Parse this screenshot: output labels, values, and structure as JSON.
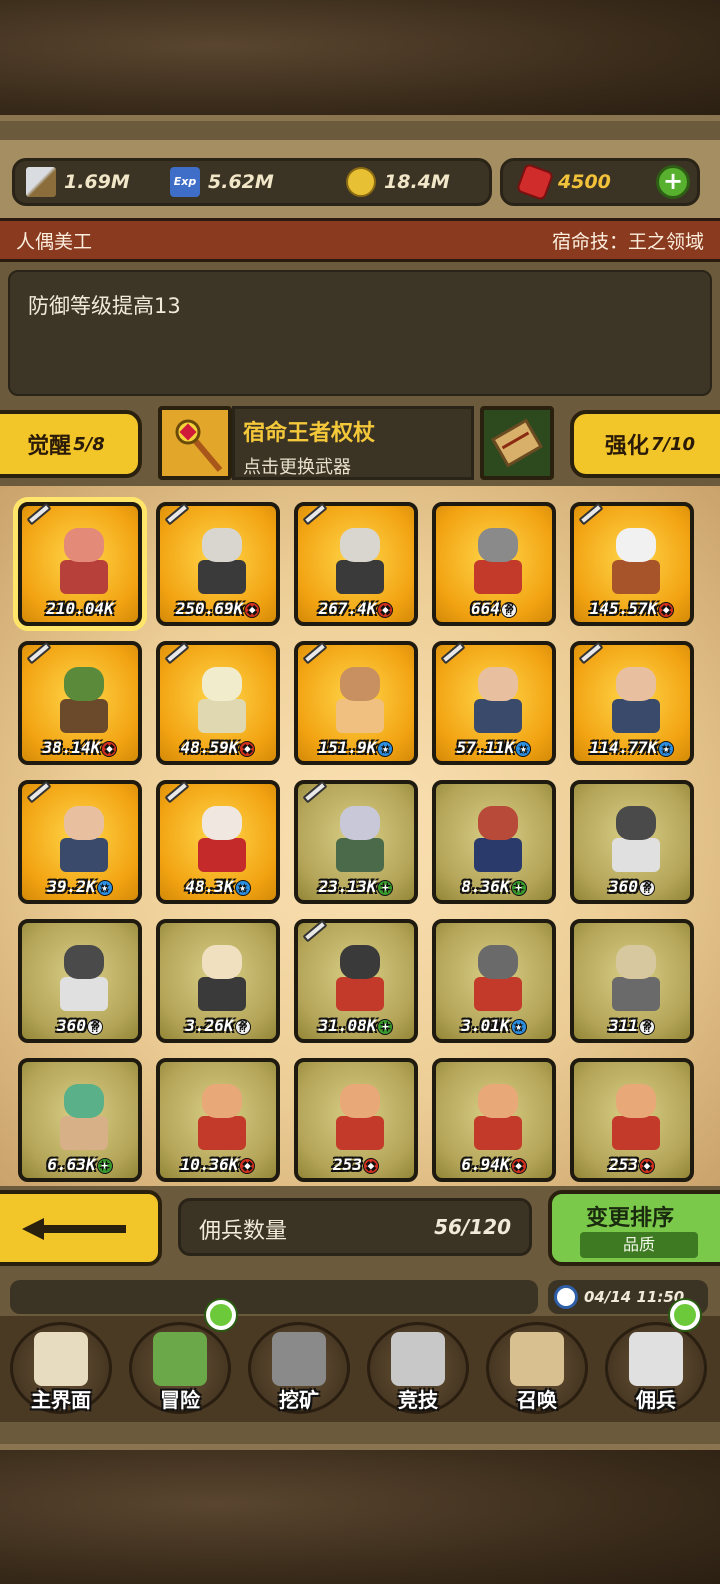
{
  "currency": {
    "attack": "1.69M",
    "exp": "5.62M",
    "gold": "18.4M",
    "ruby": "4500"
  },
  "destiny": {
    "name": "人偶美工",
    "skill": "宿命技：王之领域",
    "description": "防御等级提高13"
  },
  "awaken": {
    "label": "觉醒",
    "value": "5/8"
  },
  "enhance": {
    "label": "强化",
    "value": "7/10"
  },
  "weapon": {
    "name": "宿命王者权杖",
    "hint": "点击更换武器"
  },
  "heroes": [
    {
      "value": "210.04K",
      "badge": "",
      "frame": "gold",
      "sword": true
    },
    {
      "value": "250.69K",
      "badge": "red",
      "frame": "gold",
      "sword": true
    },
    {
      "value": "267.4K",
      "badge": "red",
      "frame": "gold",
      "sword": true
    },
    {
      "value": "664",
      "badge": "white",
      "frame": "gold",
      "sword": false
    },
    {
      "value": "145.57K",
      "badge": "red",
      "frame": "gold",
      "sword": true
    },
    {
      "value": "38.14K",
      "badge": "red",
      "frame": "gold",
      "sword": true
    },
    {
      "value": "48.59K",
      "badge": "red",
      "frame": "gold",
      "sword": true
    },
    {
      "value": "151.9K",
      "badge": "blue",
      "frame": "gold",
      "sword": true
    },
    {
      "value": "57.11K",
      "badge": "blue",
      "frame": "gold",
      "sword": true
    },
    {
      "value": "114.77K",
      "badge": "blue",
      "frame": "gold",
      "sword": true
    },
    {
      "value": "39.2K",
      "badge": "blue",
      "frame": "gold",
      "sword": true
    },
    {
      "value": "48.3K",
      "badge": "blue",
      "frame": "gold",
      "sword": true
    },
    {
      "value": "23.13K",
      "badge": "green",
      "frame": "olive",
      "sword": true
    },
    {
      "value": "8.36K",
      "badge": "green",
      "frame": "olive",
      "sword": false
    },
    {
      "value": "360",
      "badge": "white",
      "frame": "olive",
      "sword": false
    },
    {
      "value": "360",
      "badge": "white",
      "frame": "olive",
      "sword": false
    },
    {
      "value": "3.26K",
      "badge": "white",
      "frame": "olive",
      "sword": false
    },
    {
      "value": "31.08K",
      "badge": "green",
      "frame": "olive",
      "sword": true
    },
    {
      "value": "3.01K",
      "badge": "blue",
      "frame": "olive",
      "sword": false
    },
    {
      "value": "311",
      "badge": "white",
      "frame": "olive",
      "sword": false
    },
    {
      "value": "6.63K",
      "badge": "green",
      "frame": "olive",
      "sword": false
    },
    {
      "value": "10.36K",
      "badge": "red",
      "frame": "olive",
      "sword": false
    },
    {
      "value": "253",
      "badge": "red",
      "frame": "olive",
      "sword": false
    },
    {
      "value": "6.94K",
      "badge": "red",
      "frame": "olive",
      "sword": false
    },
    {
      "value": "253",
      "badge": "red",
      "frame": "olive",
      "sword": false
    }
  ],
  "mercenary": {
    "label": "佣兵数量",
    "count": "56/120"
  },
  "sort": {
    "label": "变更排序",
    "mode": "品质"
  },
  "clock": "04/14 11:50",
  "nav": [
    {
      "label": "主界面",
      "icon": "map-scroll-icon"
    },
    {
      "label": "冒险",
      "icon": "island-icon"
    },
    {
      "label": "挖矿",
      "icon": "pickaxe-icon"
    },
    {
      "label": "竞技",
      "icon": "crossed-swords-icon"
    },
    {
      "label": "召唤",
      "icon": "summon-scroll-icon"
    },
    {
      "label": "佣兵",
      "icon": "tent-icon"
    }
  ],
  "colors": {
    "gold_frame": "#f2a312",
    "olive_frame": "#b3a458",
    "accent_yellow": "#f2c529",
    "accent_green": "#7bc94a",
    "destiny_bar": "#8a3a1f"
  }
}
